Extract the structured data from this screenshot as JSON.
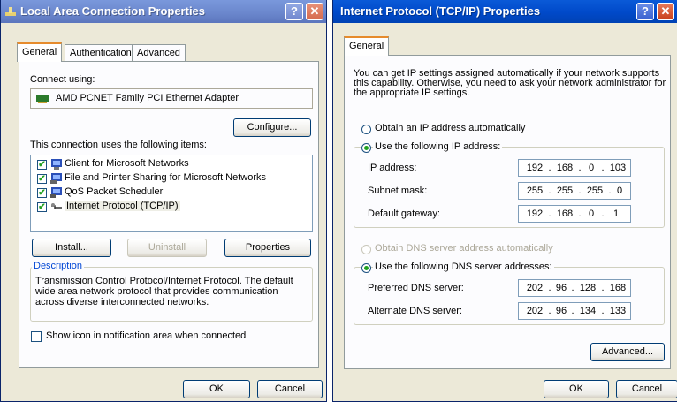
{
  "left": {
    "title": "Local Area Connection Properties",
    "help": "?",
    "close": "✕",
    "tabs": [
      "General",
      "Authentication",
      "Advanced"
    ],
    "connect_using_label": "Connect using:",
    "adapter": "AMD PCNET Family PCI Ethernet Adapter",
    "configure": "Configure...",
    "items_label": "This connection uses the following items:",
    "items": [
      {
        "label": "Client for Microsoft Networks",
        "checked": true
      },
      {
        "label": "File and Printer Sharing for Microsoft Networks",
        "checked": true
      },
      {
        "label": "QoS Packet Scheduler",
        "checked": true
      },
      {
        "label": "Internet Protocol (TCP/IP)",
        "checked": true
      }
    ],
    "install": "Install...",
    "uninstall": "Uninstall",
    "properties": "Properties",
    "description_title": "Description",
    "description_lines": [
      "Transmission Control Protocol/Internet Protocol. The default",
      "wide area network protocol that provides communication",
      "across diverse interconnected networks."
    ],
    "show_icon": "Show icon in notification area when connected",
    "ok": "OK",
    "cancel": "Cancel"
  },
  "right": {
    "title": "Internet Protocol (TCP/IP) Properties",
    "help": "?",
    "close": "✕",
    "tab": "General",
    "intro_lines": [
      "You can get IP settings assigned automatically if your network supports",
      "this capability. Otherwise, you need to ask your network administrator for",
      "the appropriate IP settings."
    ],
    "obtain_ip": "Obtain an IP address automatically",
    "use_ip": "Use the following IP address:",
    "ip_label": "IP address:",
    "ip": [
      "192",
      "168",
      "0",
      "103"
    ],
    "subnet_label": "Subnet mask:",
    "subnet": [
      "255",
      "255",
      "255",
      "0"
    ],
    "gateway_label": "Default gateway:",
    "gateway": [
      "192",
      "168",
      "0",
      "1"
    ],
    "obtain_dns": "Obtain DNS server address automatically",
    "use_dns": "Use the following DNS server addresses:",
    "pref_dns_label": "Preferred DNS server:",
    "pref_dns": [
      "202",
      "96",
      "128",
      "168"
    ],
    "alt_dns_label": "Alternate DNS server:",
    "alt_dns": [
      "202",
      "96",
      "134",
      "133"
    ],
    "advanced": "Advanced...",
    "ok": "OK",
    "cancel": "Cancel"
  }
}
